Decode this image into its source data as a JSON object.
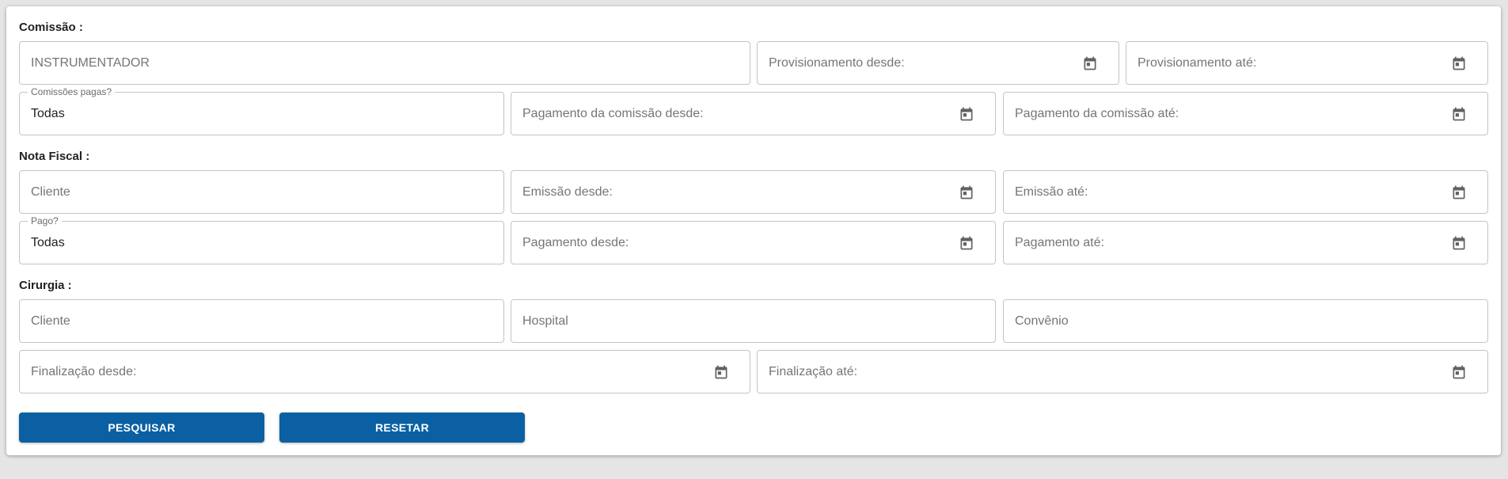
{
  "comissao": {
    "title": "Comissão :",
    "instrumentador_placeholder": "INSTRUMENTADOR",
    "prov_desde_placeholder": "Provisionamento desde:",
    "prov_ate_placeholder": "Provisionamento até:",
    "pagas_label": "Comissões pagas?",
    "pagas_value": "Todas",
    "pag_desde_placeholder": "Pagamento da comissão desde:",
    "pag_ate_placeholder": "Pagamento da comissão até:"
  },
  "nota_fiscal": {
    "title": "Nota Fiscal :",
    "cliente_placeholder": "Cliente",
    "emissao_desde_placeholder": "Emissão desde:",
    "emissao_ate_placeholder": "Emissão até:",
    "pago_label": "Pago?",
    "pago_value": "Todas",
    "pagamento_desde_placeholder": "Pagamento desde:",
    "pagamento_ate_placeholder": "Pagamento até:"
  },
  "cirurgia": {
    "title": "Cirurgia :",
    "cliente_placeholder": "Cliente",
    "hospital_placeholder": "Hospital",
    "convenio_placeholder": "Convênio",
    "finalizacao_desde_placeholder": "Finalização desde:",
    "finalizacao_ate_placeholder": "Finalização até:"
  },
  "actions": {
    "search_label": "PESQUISAR",
    "reset_label": "RESETAR"
  },
  "icons": {
    "calendar": "calendar-icon",
    "color": "#616161"
  },
  "colors": {
    "button_bg": "#0b60a3",
    "border": "#c4c4c4"
  }
}
